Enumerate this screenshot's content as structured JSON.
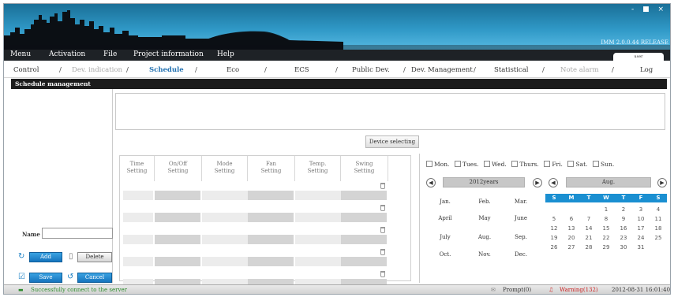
{
  "window": {
    "version": "IMM 2.0.0.44 RELEASE",
    "controls": "- ■ ×",
    "user_tab": "user"
  },
  "menu": [
    "Menu",
    "Activation",
    "File",
    "Project information",
    "Help"
  ],
  "nav": [
    {
      "label": "Control",
      "state": "normal"
    },
    {
      "label": "Dev. indication",
      "state": "disabled"
    },
    {
      "label": "Schedule",
      "state": "active"
    },
    {
      "label": "Eco",
      "state": "normal"
    },
    {
      "label": "ECS",
      "state": "normal"
    },
    {
      "label": "Public Dev.",
      "state": "normal"
    },
    {
      "label": "Dev. Management",
      "state": "normal"
    },
    {
      "label": "Statistical",
      "state": "normal"
    },
    {
      "label": "Note alarm",
      "state": "disabled"
    },
    {
      "label": "Log",
      "state": "normal"
    }
  ],
  "nav_separator": "/",
  "section_title": "Schedule management",
  "device_button": "Device selecting",
  "grid_headers": [
    "Time\nSetting",
    "On/Off\nSetting",
    "Mode\nSetting",
    "Fan\nSetting",
    "Temp.\nSetting",
    "Swing\nSetting"
  ],
  "weekdays": [
    "Mon.",
    "Tues.",
    "Wed.",
    "Thurs.",
    "Fri.",
    "Sat.",
    "Sun."
  ],
  "calendar": {
    "year_label": "2012years",
    "month_label": "Aug.",
    "prev": "◀",
    "next": "▶",
    "months": [
      "Jan.",
      "Feb.",
      "Mar.",
      "April",
      "May",
      "June",
      "July",
      "Aug.",
      "Sep.",
      "Oct.",
      "Nov.",
      "Dec."
    ],
    "week_header": [
      "S",
      "M",
      "T",
      "W",
      "T",
      "F",
      "S"
    ],
    "days": [
      [
        "",
        "",
        "",
        "1",
        "2",
        "3",
        "4"
      ],
      [
        "5",
        "6",
        "7",
        "8",
        "9",
        "10",
        "11"
      ],
      [
        "12",
        "13",
        "14",
        "15",
        "16",
        "17",
        "18"
      ],
      [
        "19",
        "20",
        "21",
        "22",
        "23",
        "24",
        "25"
      ],
      [
        "26",
        "27",
        "28",
        "29",
        "30",
        "31",
        ""
      ]
    ]
  },
  "left_panel": {
    "name_label": "Name",
    "name_value": "",
    "add": "Add",
    "delete": "Delete",
    "save": "Save",
    "cancel": "Cancel"
  },
  "status": {
    "message": "Successfully connect to the server",
    "prompt": "Prompt(0)",
    "warning": "Warning(132)",
    "datetime": "2012-08-31 16:01:40"
  },
  "colors": {
    "accent": "#1a8fd1",
    "menubar": "#1e2226",
    "active_tab": "#1f6fb0",
    "status_ok": "#2e8b2e",
    "warning": "#cc2222"
  }
}
